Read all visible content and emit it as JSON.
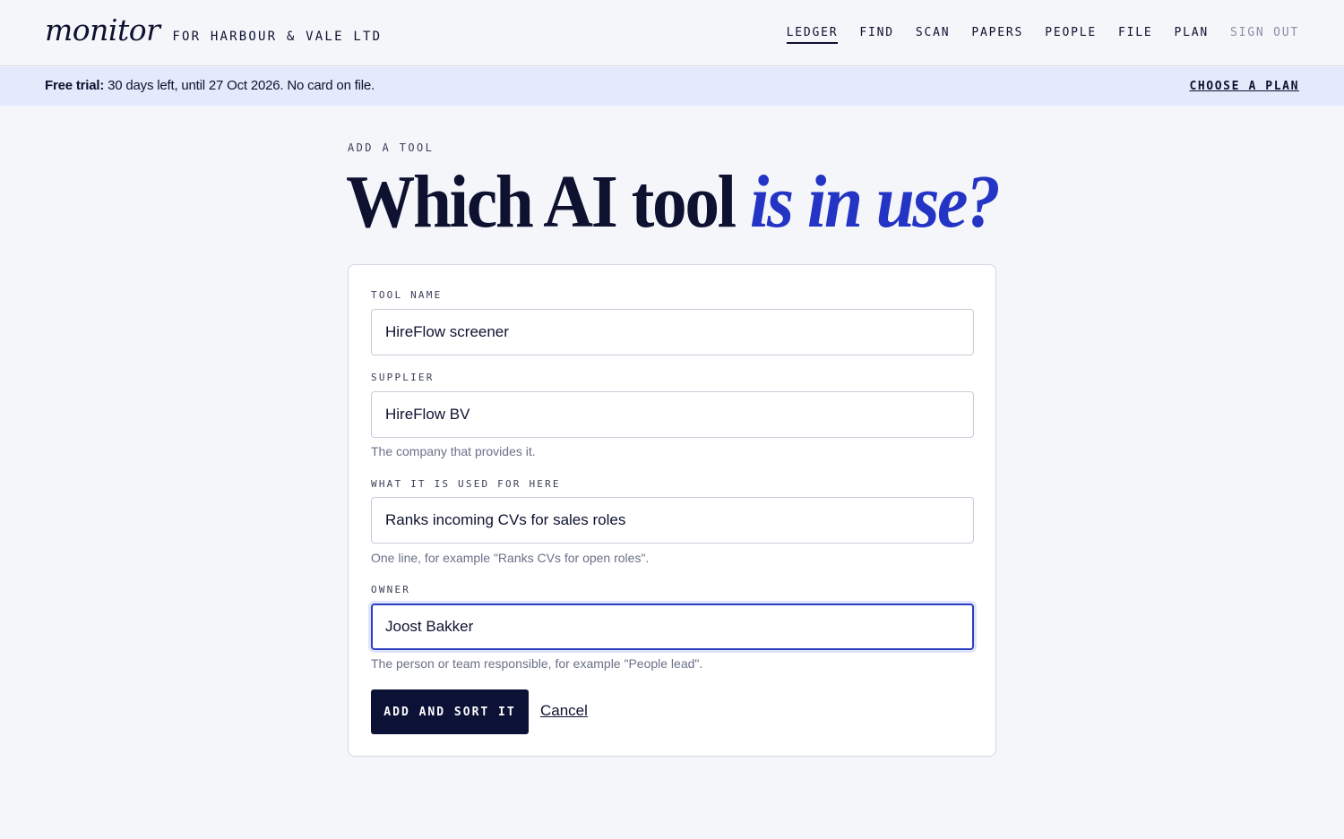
{
  "header": {
    "logo": "monitor",
    "org": "FOR HARBOUR & VALE LTD",
    "nav": [
      {
        "label": "LEDGER",
        "active": true
      },
      {
        "label": "FIND"
      },
      {
        "label": "SCAN"
      },
      {
        "label": "PAPERS"
      },
      {
        "label": "PEOPLE"
      },
      {
        "label": "FILE"
      },
      {
        "label": "PLAN"
      },
      {
        "label": "SIGN OUT",
        "muted": true
      }
    ]
  },
  "banner": {
    "strong": "Free trial:",
    "text": " 30 days left, until 27 Oct 2026. No card on file.",
    "link": "CHOOSE A PLAN"
  },
  "page": {
    "eyebrow": "ADD A TOOL",
    "title_plain": "Which AI tool ",
    "title_accent": "is in use?"
  },
  "form": {
    "tool_name": {
      "label": "TOOL NAME",
      "value": "HireFlow screener"
    },
    "supplier": {
      "label": "SUPPLIER",
      "value": "HireFlow BV",
      "hint": "The company that provides it."
    },
    "purpose": {
      "label": "WHAT IT IS USED FOR HERE",
      "value": "Ranks incoming CVs for sales roles",
      "hint": "One line, for example \"Ranks CVs for open roles\"."
    },
    "owner": {
      "label": "OWNER",
      "value": "Joost Bakker",
      "hint": "The person or team responsible, for example \"People lead\"."
    },
    "submit_label": "ADD AND SORT IT",
    "cancel_label": "Cancel"
  },
  "colors": {
    "ink": "#0e1230",
    "accent": "#2434c4",
    "banner_bg": "#e4e9fb",
    "button_bg": "#0c1236",
    "focus_border": "#2a3fbf"
  }
}
